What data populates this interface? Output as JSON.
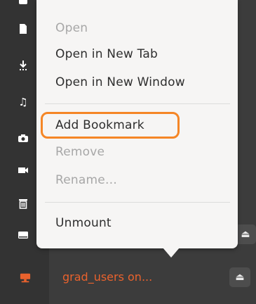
{
  "menu": {
    "items": [
      {
        "label": "Open",
        "enabled": false
      },
      {
        "label": "Open in New Tab",
        "enabled": true
      },
      {
        "label": "Open in New Window",
        "enabled": true
      },
      {
        "label": "Add Bookmark",
        "enabled": true,
        "highlighted": true
      },
      {
        "label": "Remove",
        "enabled": false
      },
      {
        "label": "Rename…",
        "enabled": false
      },
      {
        "label": "Unmount",
        "enabled": true
      }
    ]
  },
  "sidebar": {
    "icons": [
      "image-icon",
      "document-icon",
      "download-icon",
      "music-icon",
      "camera-icon",
      "video-icon",
      "trash-icon",
      "drive-icon",
      "network-drive-icon"
    ],
    "active_item": {
      "label": "grad_users on..."
    }
  },
  "colors": {
    "accent": "#e9622d",
    "highlight_ring": "#f58626",
    "menu_bg": "#f6f5f4",
    "sidebar_bg": "#3c3c3c"
  }
}
